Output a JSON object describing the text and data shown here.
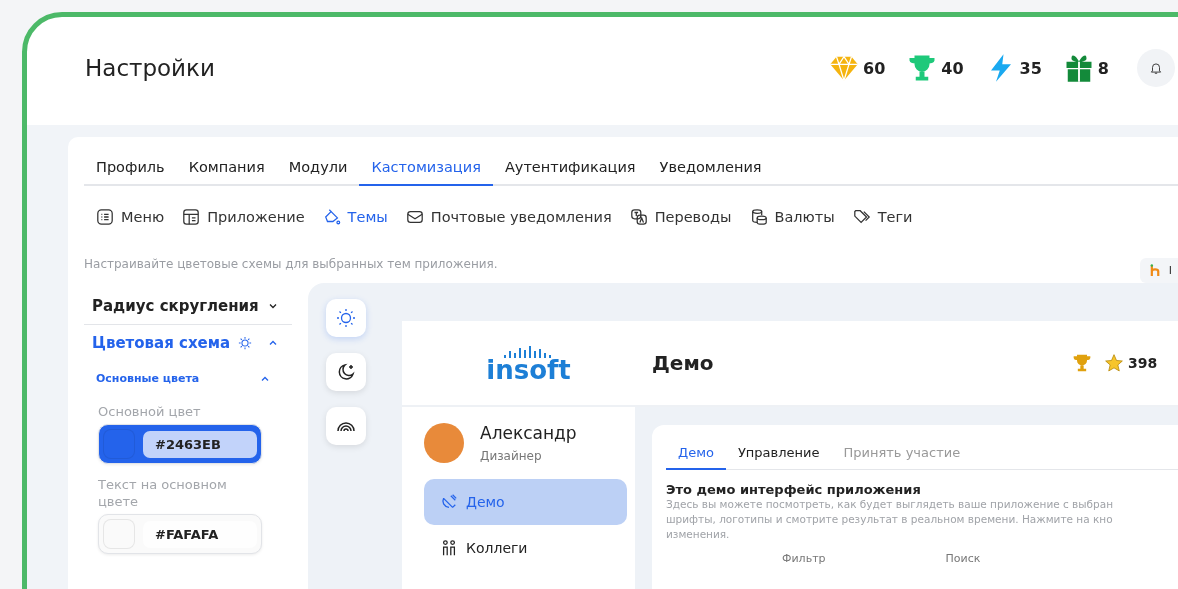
{
  "header": {
    "title": "Настройки",
    "stats": [
      {
        "value": "60"
      },
      {
        "value": "40"
      },
      {
        "value": "35"
      },
      {
        "value": "8"
      }
    ]
  },
  "tabs": [
    {
      "label": "Профиль",
      "selected": false
    },
    {
      "label": "Компания",
      "selected": false
    },
    {
      "label": "Модули",
      "selected": false
    },
    {
      "label": "Кастомизация",
      "selected": true
    },
    {
      "label": "Аутентификация",
      "selected": false
    },
    {
      "label": "Уведомления",
      "selected": false
    }
  ],
  "subtabs": [
    {
      "label": "Меню",
      "selected": false
    },
    {
      "label": "Приложение",
      "selected": false
    },
    {
      "label": "Темы",
      "selected": true
    },
    {
      "label": "Почтовые уведомления",
      "selected": false
    },
    {
      "label": "Переводы",
      "selected": false
    },
    {
      "label": "Валюты",
      "selected": false
    },
    {
      "label": "Теги",
      "selected": false
    }
  ],
  "hint": "Настраивайте цветовые схемы для выбранных тем приложения.",
  "corner_chip": {
    "text": "I"
  },
  "settings": {
    "sections": [
      {
        "title": "Радиус скругления",
        "expanded": false
      },
      {
        "title": "Цветовая схема",
        "expanded": true
      }
    ],
    "group": {
      "title": "Основные цвета",
      "expanded": true
    },
    "fields": [
      {
        "label": "Основной цвет",
        "value": "#2463EB",
        "color": "#2463eb"
      },
      {
        "label": "Текст на основном цвете",
        "value": "#FAFAFA",
        "color": "#fafafa"
      }
    ]
  },
  "preview": {
    "themes": [
      {
        "selected": true
      },
      {
        "selected": false
      },
      {
        "selected": false
      }
    ],
    "logo": "insoft",
    "title": "Демо",
    "points": "398",
    "user": {
      "name": "Александр",
      "role": "Дизайнер"
    },
    "nav": [
      {
        "label": "Демо",
        "selected": true
      },
      {
        "label": "Коллеги",
        "selected": false
      }
    ],
    "tabs": [
      {
        "label": "Демо",
        "selected": true,
        "disabled": false
      },
      {
        "label": "Управление",
        "selected": false,
        "disabled": false
      },
      {
        "label": "Принять участие",
        "selected": false,
        "disabled": true
      }
    ],
    "heading": "Это демо интерфейс приложения",
    "description": "Здесь вы можете посмотреть, как будет выглядеть ваше приложение с выбран\nшрифты, логотипы и смотрите результат в реальном времени. Нажмите на кно\nизменения.",
    "filters": [
      "Фильтр",
      "Поиск"
    ]
  }
}
